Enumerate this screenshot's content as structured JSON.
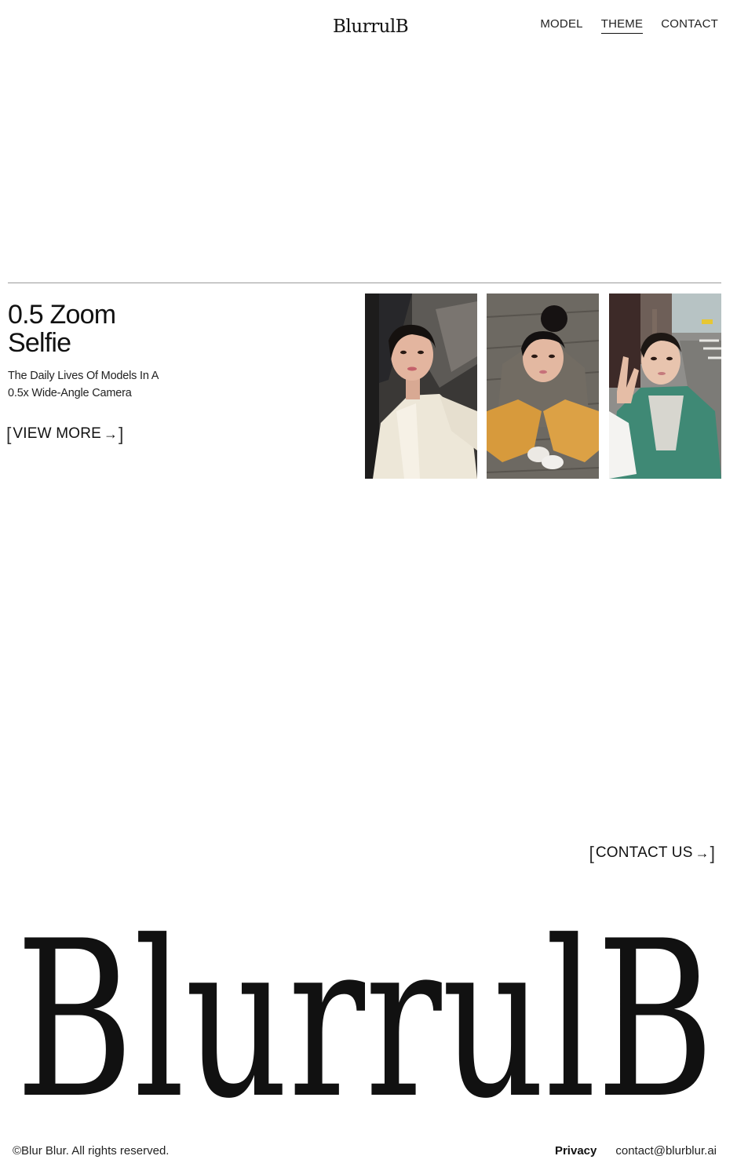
{
  "header": {
    "logo": "BlurrulB",
    "nav": [
      {
        "label": "MODEL",
        "active": false
      },
      {
        "label": "THEME",
        "active": true
      },
      {
        "label": "CONTACT",
        "active": false
      }
    ]
  },
  "theme": {
    "title_line1": "0.5 Zoom",
    "title_line2": "Selfie",
    "desc_line1": "The Daily Lives Of Models In A",
    "desc_line2": "0.5x Wide-Angle Camera",
    "view_more": "VIEW MORE",
    "photos": [
      {
        "icon": "photo-model-white-jacket"
      },
      {
        "icon": "photo-model-grey-hoodie"
      },
      {
        "icon": "photo-model-green-jacket"
      }
    ]
  },
  "footer": {
    "contact_us": "CONTACT US",
    "big_logo": "BlurrulB",
    "copyright": "©Blur Blur. All rights reserved.",
    "privacy": "Privacy",
    "email": "contact@blurblur.ai"
  },
  "colors": {
    "text": "#111111",
    "divider": "#9a9a9a",
    "background": "#ffffff"
  }
}
